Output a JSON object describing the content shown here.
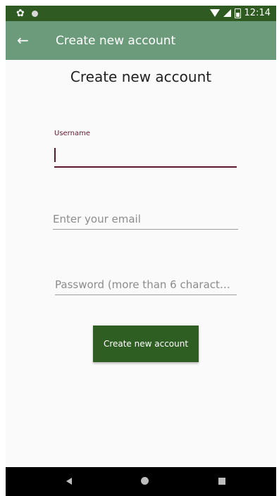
{
  "status_bar": {
    "time": "12:14",
    "icons": [
      "settings-icon",
      "circle-icon",
      "wifi-icon",
      "signal-icon",
      "battery-icon"
    ],
    "background": "#2f5b23"
  },
  "app_bar": {
    "title": "Create new account",
    "back_icon": "arrow-left-icon",
    "back_glyph": "←",
    "background": "#6c9b7c"
  },
  "form": {
    "heading": "Create new account",
    "username": {
      "label": "Username",
      "value": "",
      "placeholder": ""
    },
    "email": {
      "value": "",
      "placeholder": "Enter your email"
    },
    "password": {
      "value": "",
      "placeholder": "Password (more than 6 charact…"
    },
    "submit_label": "Create new account",
    "accent_color": "#5a1a2b",
    "button_color": "#2f5e22"
  },
  "nav_bar": {
    "icons": [
      "nav-back-icon",
      "nav-home-icon",
      "nav-recents-icon"
    ]
  }
}
